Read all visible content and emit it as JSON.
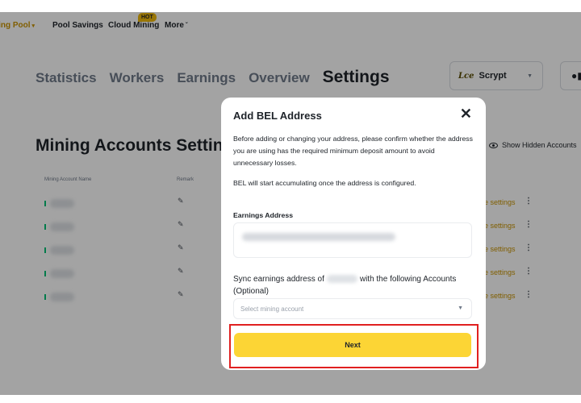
{
  "topnav": {
    "mining_pool": "ning Pool",
    "pool_savings": "Pool Savings",
    "cloud_mining": "Cloud Mining",
    "hot_badge": "HOT",
    "more": "More"
  },
  "page": {
    "tabs": [
      {
        "label": "Statistics"
      },
      {
        "label": "Workers"
      },
      {
        "label": "Earnings"
      },
      {
        "label": "Overview"
      },
      {
        "label": "Settings",
        "active": true
      }
    ],
    "coin_logo": "Lce",
    "coin": "Scrypt",
    "section_title": "Mining Accounts Settings",
    "show_hidden": "Show Hidden Accounts",
    "columns": {
      "name": "Mining Account Name",
      "remark": "Remark"
    },
    "row_action": "re settings",
    "status_color": "#02c076",
    "accent_color": "#f0b90b"
  },
  "modal": {
    "title": "Add BEL Address",
    "description": "Before adding or changing your address, please confirm whether the address you are using has the required minimum deposit amount to avoid unnecessary losses.",
    "note": "BEL will start accumulating once the address is configured.",
    "earnings_label": "Earnings Address",
    "sync_prefix": "Sync earnings address of",
    "sync_suffix": "with the following Accounts (Optional)",
    "select_placeholder": "Select mining account",
    "next_label": "Next",
    "button_color": "#fcd535",
    "highlight_color": "#e02020"
  }
}
